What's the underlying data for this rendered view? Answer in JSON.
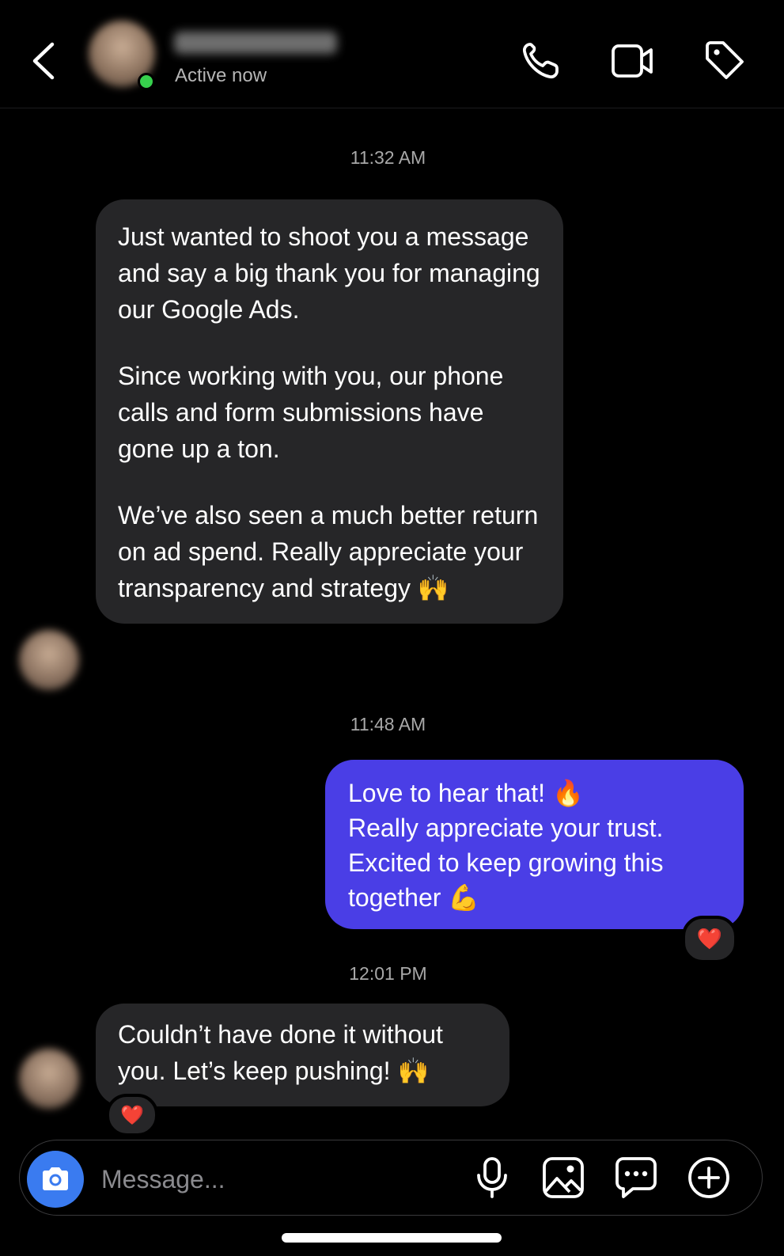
{
  "header": {
    "status": "Active now",
    "icons": [
      "back-chevron-icon",
      "phone-icon",
      "video-camera-icon",
      "tag-icon"
    ]
  },
  "colors": {
    "background": "#000000",
    "received_bubble": "#262628",
    "sent_bubble": "#4a3ee6",
    "online_dot": "#37d04d",
    "camera_button": "#3a7bf0"
  },
  "messages": {
    "ts1": "11:32 AM",
    "m1": {
      "p1": "Just wanted to shoot you a message and say a big thank you for managing our Google Ads.",
      "p2": "Since working with you, our phone calls and form submissions have gone up a ton.",
      "p3": "We’ve also seen a much better return on ad spend. Really appreciate your transparency and strategy 🙌"
    },
    "ts2": "11:48 AM",
    "m2": {
      "l1": "Love to hear that! 🔥",
      "l2": "Really appreciate your trust.",
      "l3": "Excited to keep growing this together 💪",
      "reaction": "❤️"
    },
    "ts3": "12:01 PM",
    "m3": {
      "text": "Couldn’t have done it without you. Let’s keep pushing! 🙌",
      "reaction": "❤️"
    }
  },
  "composer": {
    "placeholder": "Message...",
    "icons": [
      "camera-icon",
      "microphone-icon",
      "image-icon",
      "sticker-chat-icon",
      "plus-circle-icon"
    ]
  }
}
